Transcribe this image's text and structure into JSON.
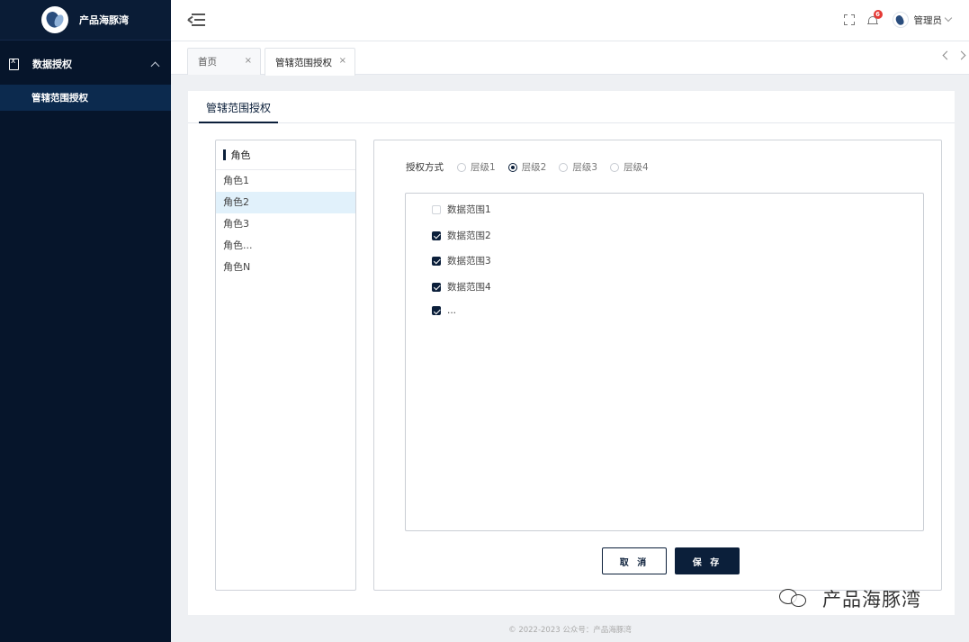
{
  "sidebar": {
    "app_name": "产品海豚湾",
    "menu": {
      "label": "数据授权",
      "icon": "document-icon",
      "expanded": true
    },
    "submenu": {
      "label": "管辖范围授权",
      "selected": true
    }
  },
  "header": {
    "notification_count": "6",
    "user_name": "管理员"
  },
  "tabs": [
    {
      "label": "首页",
      "close": "×"
    },
    {
      "label": "管辖范围授权",
      "close": "×"
    }
  ],
  "page": {
    "tab_title": "管辖范围授权",
    "role_header": "角色",
    "roles": [
      "角色1",
      "角色2",
      "角色3",
      "角色...",
      "角色N"
    ],
    "selected_role": "角色2",
    "auth_label": "授权方式",
    "levels": [
      {
        "label": "层级1",
        "checked": false
      },
      {
        "label": "层级2",
        "checked": true
      },
      {
        "label": "层级3",
        "checked": false
      },
      {
        "label": "层级4",
        "checked": false
      }
    ],
    "scopes": [
      {
        "label": "数据范围1",
        "checked": false
      },
      {
        "label": "数据范围2",
        "checked": true
      },
      {
        "label": "数据范围3",
        "checked": true
      },
      {
        "label": "数据范围4",
        "checked": true
      },
      {
        "label": "...",
        "checked": true
      }
    ],
    "cancel_label": "取 消",
    "save_label": "保 存"
  },
  "watermark": "产品海豚湾",
  "footer": "© 2022-2023 公众号：产品海豚湾",
  "colors": {
    "sidebar_bg": "#06152b",
    "accent": "#0b1f3a",
    "selected_row": "#e1f1fb",
    "badge": "#e53935"
  }
}
